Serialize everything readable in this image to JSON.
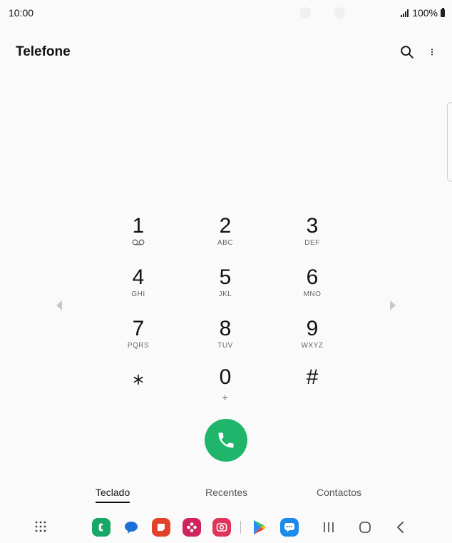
{
  "status_bar": {
    "time": "10:00",
    "battery": "100%"
  },
  "header": {
    "title": "Telefone",
    "search_icon": "search-icon",
    "more_icon": "more-vertical-icon"
  },
  "keypad": {
    "keys": [
      {
        "digit": "1",
        "letters": "",
        "icon": "voicemail-icon"
      },
      {
        "digit": "2",
        "letters": "ABC"
      },
      {
        "digit": "3",
        "letters": "DEF"
      },
      {
        "digit": "4",
        "letters": "GHI"
      },
      {
        "digit": "5",
        "letters": "JKL"
      },
      {
        "digit": "6",
        "letters": "MNO"
      },
      {
        "digit": "7",
        "letters": "PQRS"
      },
      {
        "digit": "8",
        "letters": "TUV"
      },
      {
        "digit": "9",
        "letters": "WXYZ"
      },
      {
        "digit": "⁎",
        "letters": ""
      },
      {
        "digit": "0",
        "letters": "+"
      },
      {
        "digit": "#",
        "letters": ""
      }
    ]
  },
  "call_button": {
    "icon": "phone-icon",
    "color": "#1fb56b"
  },
  "tabs": [
    {
      "label": "Teclado",
      "active": true
    },
    {
      "label": "Recentes",
      "active": false
    },
    {
      "label": "Contactos",
      "active": false
    }
  ],
  "nav_bar": {
    "apps": [
      {
        "name": "apps-grid-icon"
      },
      {
        "name": "phone-app-icon",
        "color": "#17a865"
      },
      {
        "name": "messages-app-icon",
        "color": "#1b6fd8"
      },
      {
        "name": "notes-app-icon",
        "color": "#e2412a"
      },
      {
        "name": "gallery-app-icon",
        "color": "#d0245d"
      },
      {
        "name": "camera-app-icon",
        "color": "#e0355a"
      },
      {
        "name": "play-store-icon"
      },
      {
        "name": "chat-app-icon",
        "color": "#1a8bea"
      }
    ],
    "buttons": [
      "recents-button",
      "home-button",
      "back-button"
    ]
  }
}
